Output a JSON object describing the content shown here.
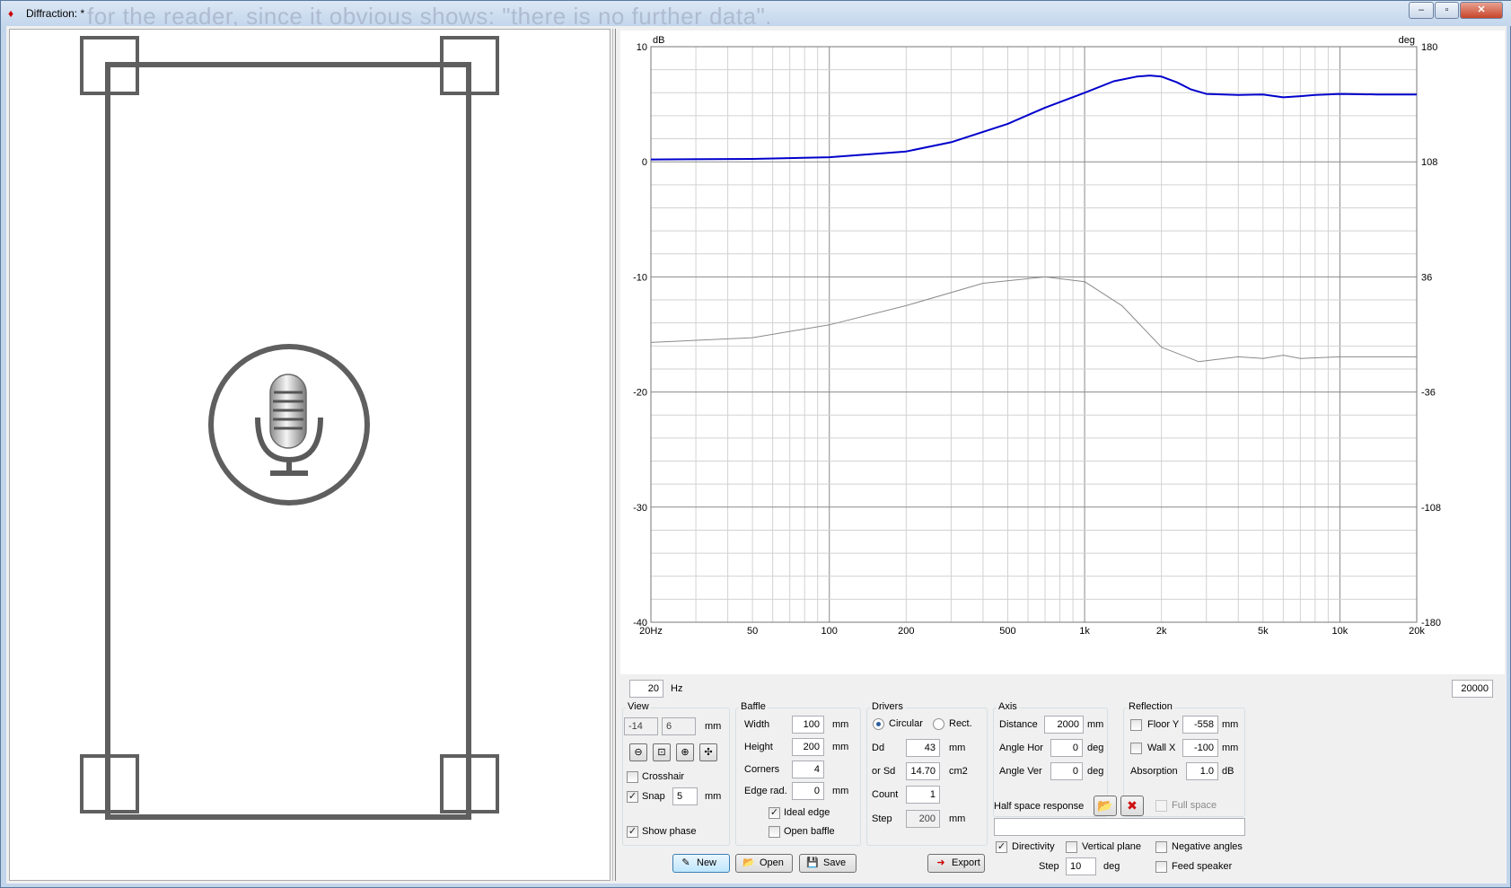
{
  "window": {
    "title": "Diffraction: *",
    "ghost_text": "for the reader, since it obvious shows: \"there is no further data\".",
    "minimize": "–",
    "maximize": "▫",
    "close": "✕"
  },
  "chart_data": {
    "type": "line",
    "left_unit": "dB",
    "right_unit": "deg",
    "x_scale": "log",
    "xlim": [
      20,
      20000
    ],
    "ylim": [
      -40,
      10
    ],
    "y2lim": [
      -180,
      180
    ],
    "x_ticks": [
      {
        "v": 20,
        "l": "20Hz"
      },
      {
        "v": 50,
        "l": "50"
      },
      {
        "v": 100,
        "l": "100"
      },
      {
        "v": 200,
        "l": "200"
      },
      {
        "v": 500,
        "l": "500"
      },
      {
        "v": 1000,
        "l": "1k"
      },
      {
        "v": 2000,
        "l": "2k"
      },
      {
        "v": 5000,
        "l": "5k"
      },
      {
        "v": 10000,
        "l": "10k"
      },
      {
        "v": 20000,
        "l": "20k"
      }
    ],
    "y_ticks": [
      "10",
      "0",
      "-10",
      "-20",
      "-30",
      "-40"
    ],
    "y2_ticks": [
      "180",
      "108",
      "36",
      "-36",
      "-108",
      "-180"
    ],
    "grid": true,
    "series": [
      {
        "axis": "left",
        "unit": "dB",
        "color": "#0000cc",
        "x": [
          20,
          50,
          100,
          200,
          300,
          500,
          700,
          1000,
          1300,
          1600,
          1800,
          2000,
          2300,
          2600,
          3000,
          4000,
          5000,
          6000,
          7000,
          8000,
          10000,
          14000,
          20000
        ],
        "y": [
          0.2,
          0.25,
          0.4,
          0.9,
          1.7,
          3.3,
          4.7,
          6.0,
          7.0,
          7.4,
          7.5,
          7.4,
          6.9,
          6.3,
          5.9,
          5.8,
          5.85,
          5.6,
          5.7,
          5.8,
          5.9,
          5.85,
          5.85
        ]
      },
      {
        "axis": "right",
        "unit": "deg",
        "color": "#8a8a8a",
        "x": [
          20,
          50,
          100,
          200,
          400,
          700,
          1000,
          1400,
          2000,
          2800,
          4000,
          5000,
          6000,
          7000,
          10000,
          20000
        ],
        "y": [
          -5,
          -2,
          6,
          18,
          32,
          36,
          33,
          18,
          -8,
          -17,
          -14,
          -15,
          -13,
          -15,
          -14,
          -14
        ]
      }
    ]
  },
  "range": {
    "min_hz": "20",
    "hz": "Hz",
    "max_hz": "20000"
  },
  "view": {
    "title": "View",
    "x": "-14",
    "y": "6",
    "mm": "mm",
    "zoom_out": "⊖",
    "zoom_fit": "⊡",
    "zoom_in": "⊕",
    "zoom_all": "✣",
    "crosshair": "Crosshair",
    "snap": "Snap",
    "snap_value": "5",
    "snap_mm": "mm",
    "show_phase": "Show phase",
    "checked": "✓"
  },
  "baffle": {
    "title": "Baffle",
    "width_label": "Width",
    "width": "100",
    "height_label": "Height",
    "height": "200",
    "corners_label": "Corners",
    "corners": "4",
    "edge_label": "Edge rad.",
    "edge": "0",
    "mm": "mm",
    "ideal_edge": "Ideal edge",
    "open_baffle": "Open baffle"
  },
  "drivers": {
    "title": "Drivers",
    "circular": "Circular",
    "rect": "Rect.",
    "dd_label": "Dd",
    "dd": "43",
    "dd_unit": "mm",
    "sd_label": "or Sd",
    "sd": "14.70",
    "sd_unit": "cm2",
    "count_label": "Count",
    "count": "1",
    "step_label": "Step",
    "step": "200",
    "step_unit": "mm"
  },
  "axis": {
    "title": "Axis",
    "distance_label": "Distance",
    "distance": "2000",
    "distance_unit": "mm",
    "hor_label": "Angle Hor",
    "hor": "0",
    "ver_label": "Angle Ver",
    "ver": "0",
    "deg": "deg"
  },
  "reflection": {
    "title": "Reflection",
    "floor_label": "Floor Y",
    "floor": "-558",
    "wall_label": "Wall  X",
    "wall": "-100",
    "mm": "mm",
    "absorption_label": "Absorption",
    "absorption": "1.0",
    "absorption_unit": "dB"
  },
  "half_space": {
    "label": "Half space response",
    "open_icon": "📂",
    "delete_icon": "✖",
    "full_space": "Full space",
    "path": ""
  },
  "directivity": {
    "directivity": "Directivity",
    "vertical": "Vertical plane",
    "negative": "Negative angles",
    "feed": "Feed speaker",
    "step_label": "Step",
    "step": "10",
    "deg": "deg"
  },
  "buttons": {
    "new": "New",
    "new_icon": "✎",
    "open": "Open",
    "open_icon": "📂",
    "save": "Save",
    "save_icon": "💾",
    "export": "Export",
    "export_icon": "➜"
  },
  "colors": {
    "baffle": "#5f5f5f",
    "mag": "#0000cc",
    "phase": "#8a8a8a"
  }
}
